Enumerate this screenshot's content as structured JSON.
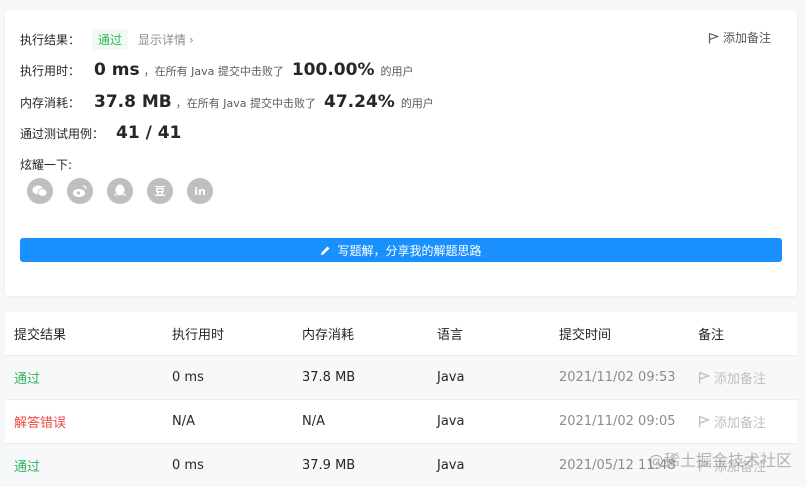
{
  "result": {
    "exec_label": "执行结果：",
    "status_badge": "通过",
    "detail_link": "显示详情",
    "detail_chevron": "›",
    "add_note": "添加备注"
  },
  "runtime": {
    "label": "执行用时：",
    "value": "0 ms",
    "mid": "，在所有 Java 提交中击败了",
    "percent": "100.00%",
    "suffix": "的用户"
  },
  "memory": {
    "label": "内存消耗：",
    "value": "37.8 MB",
    "mid": "，在所有 Java 提交中击败了",
    "percent": "47.24%",
    "suffix": "的用户"
  },
  "tests": {
    "label": "通过测试用例：",
    "value": "41 / 41"
  },
  "share": {
    "label": "炫耀一下:",
    "icons": [
      "wechat-icon",
      "weibo-icon",
      "qq-icon",
      "douban-icon",
      "linkedin-icon"
    ],
    "douban_text": "豆",
    "linkedin_text": "in"
  },
  "write_button": "写题解，分享我的解题思路",
  "table": {
    "headers": [
      "提交结果",
      "执行用时",
      "内存消耗",
      "语言",
      "提交时间",
      "备注"
    ],
    "rows": [
      {
        "status": "通过",
        "status_type": "pass",
        "time": "0 ms",
        "memory": "37.8 MB",
        "lang": "Java",
        "submitted": "2021/11/02 09:53",
        "note": "添加备注"
      },
      {
        "status": "解答错误",
        "status_type": "fail",
        "time": "N/A",
        "memory": "N/A",
        "lang": "Java",
        "submitted": "2021/11/02 09:05",
        "note": "添加备注"
      },
      {
        "status": "通过",
        "status_type": "pass",
        "time": "0 ms",
        "memory": "37.9 MB",
        "lang": "Java",
        "submitted": "2021/05/12 11:48",
        "note": "添加备注"
      }
    ]
  },
  "watermark": "@稀土掘金技术社区",
  "colors": {
    "pass": "#2db55d",
    "fail": "#ef4743",
    "primary": "#1a90ff"
  }
}
